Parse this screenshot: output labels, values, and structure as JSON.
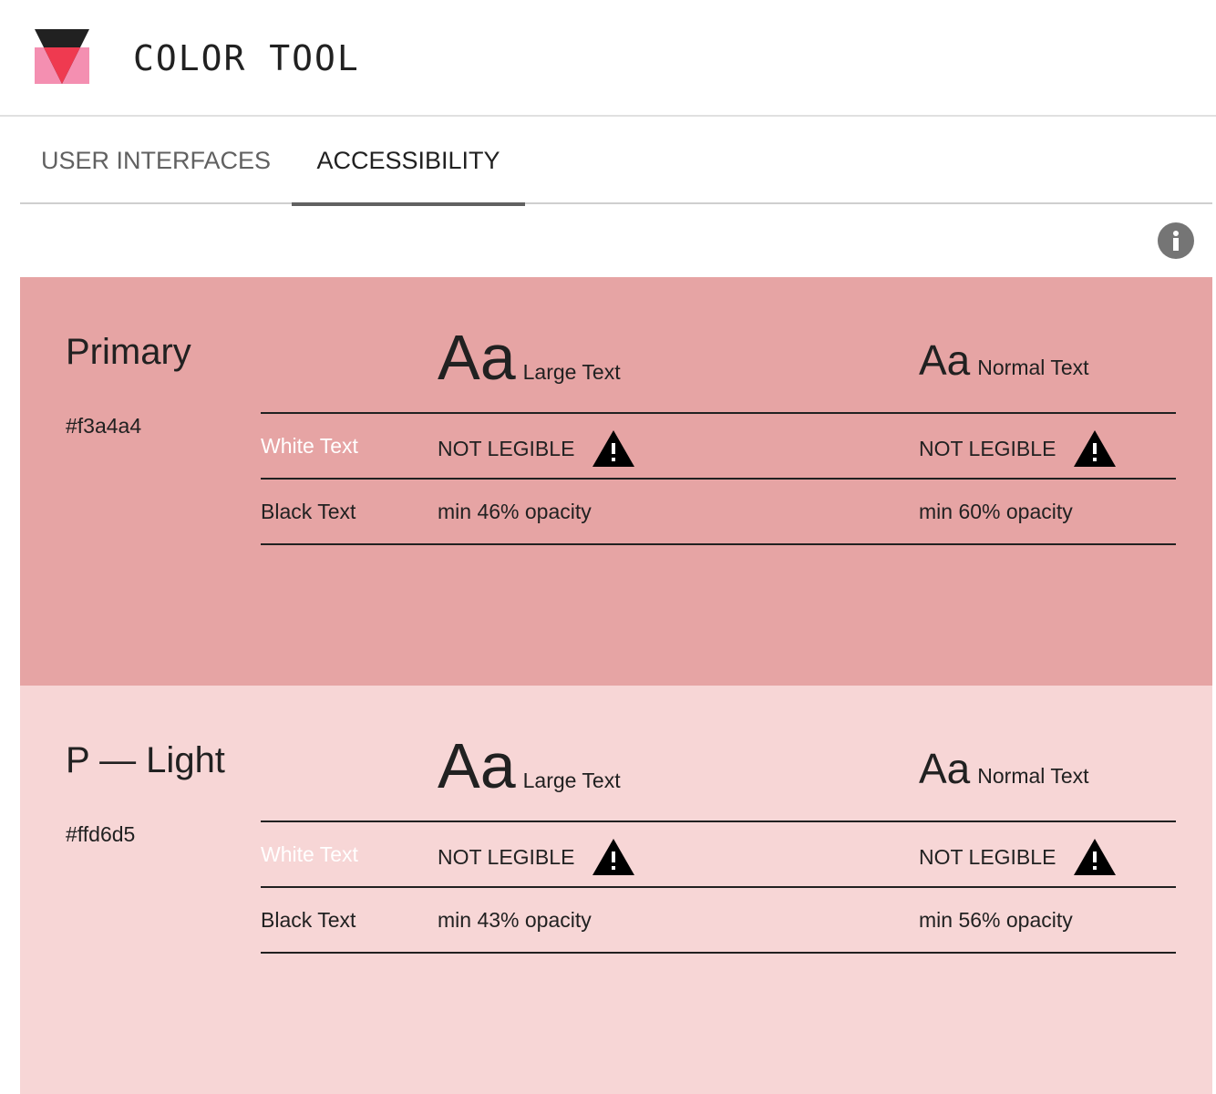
{
  "app": {
    "title": "COLOR TOOL",
    "logo_colors": {
      "top": "#212121",
      "bottom": "#f48fb1",
      "accent": "#ef3a50"
    }
  },
  "tabs": [
    {
      "label": "USER INTERFACES",
      "active": false
    },
    {
      "label": "ACCESSIBILITY",
      "active": true
    }
  ],
  "info_icon": "info-icon",
  "swatches": [
    {
      "name": "Primary",
      "hex": "#f3a4a4",
      "background": "#e6a4a4",
      "large_aa": "Aa",
      "large_label": "Large Text",
      "normal_aa": "Aa",
      "normal_label": "Normal Text",
      "white_text_label": "White Text",
      "black_text_label": "Black Text",
      "white_large": "NOT LEGIBLE",
      "white_normal": "NOT LEGIBLE",
      "black_large": "min 46% opacity",
      "black_normal": "min 60% opacity"
    },
    {
      "name": "P — Light",
      "hex": "#ffd6d5",
      "background": "#f7d6d6",
      "large_aa": "Aa",
      "large_label": "Large Text",
      "normal_aa": "Aa",
      "normal_label": "Normal Text",
      "white_text_label": "White Text",
      "black_text_label": "Black Text",
      "white_large": "NOT LEGIBLE",
      "white_normal": "NOT LEGIBLE",
      "black_large": "min 43% opacity",
      "black_normal": "min 56% opacity"
    }
  ]
}
